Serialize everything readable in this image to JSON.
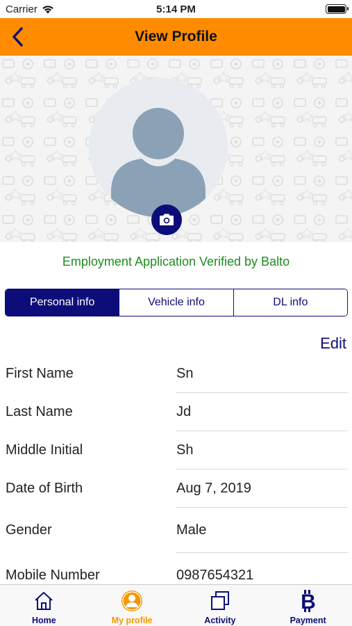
{
  "status_bar": {
    "carrier": "Carrier",
    "time": "5:14 PM",
    "battery_level": 1.0
  },
  "nav": {
    "title": "View Profile"
  },
  "profile": {
    "verification_text": "Employment Application Verified by Balto"
  },
  "tabs": [
    {
      "label": "Personal info",
      "active": true
    },
    {
      "label": "Vehicle info",
      "active": false
    },
    {
      "label": "DL info",
      "active": false
    }
  ],
  "edit_label": "Edit",
  "info": [
    {
      "label": "First Name",
      "value": "Sn"
    },
    {
      "label": "Last Name",
      "value": "Jd"
    },
    {
      "label": "Middle Initial",
      "value": "Sh"
    },
    {
      "label": "Date of Birth",
      "value": "Aug 7, 2019"
    },
    {
      "label": "Gender",
      "value": "Male"
    },
    {
      "label": "Mobile Number",
      "value": "0987654321"
    }
  ],
  "tab_bar": [
    {
      "label": "Home",
      "icon": "home-icon",
      "active": false
    },
    {
      "label": "My profile",
      "icon": "profile-icon",
      "active": true
    },
    {
      "label": "Activity",
      "icon": "activity-icon",
      "active": false
    },
    {
      "label": "Payment",
      "icon": "bitcoin-icon",
      "active": false
    }
  ],
  "colors": {
    "nav_bg": "#ff8c00",
    "primary": "#0d0d7a",
    "verified": "#1e8c1e",
    "active_tab_label": "#f39800"
  }
}
